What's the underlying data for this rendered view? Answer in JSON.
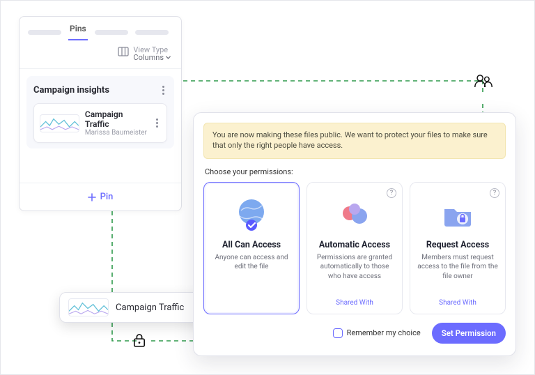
{
  "pins": {
    "tab_label": "Pins",
    "view_type_label": "View Type",
    "view_type_value": "Columns",
    "insights_title": "Campaign insights",
    "traffic_title": "Campaign Traffic",
    "traffic_author": "Marissa Baumeister",
    "pin_button_label": "Pin"
  },
  "floating": {
    "label": "Campaign Traffic"
  },
  "modal": {
    "banner": "You are now making these files public. We want to protect your files to make sure that only the right people have access.",
    "choose_label": "Choose your permissions:",
    "cards": [
      {
        "title": "All Can Access",
        "desc": "Anyone can access and edit the file",
        "shared": ""
      },
      {
        "title": "Automatic Access",
        "desc": "Permissions are granted automatically to those who have access",
        "shared": "Shared With"
      },
      {
        "title": "Request Access",
        "desc": "Members must request access to the file from the file owner",
        "shared": "Shared With"
      }
    ],
    "remember_label": "Remember my choice",
    "set_button_label": "Set Permission"
  }
}
